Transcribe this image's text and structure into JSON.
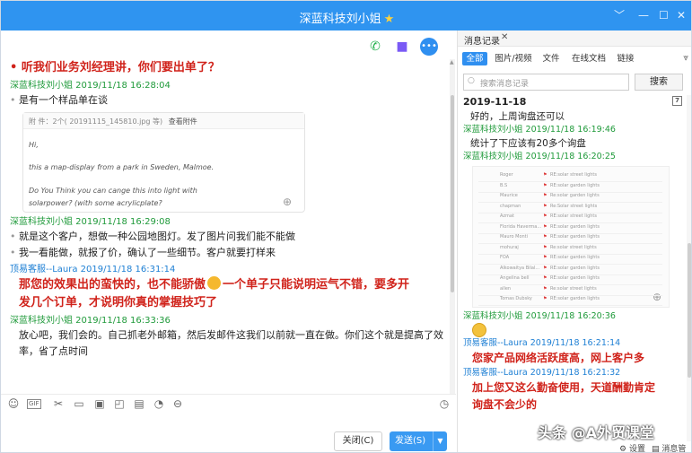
{
  "window": {
    "title": "深蓝科技刘小姐",
    "star_icon": "star-icon",
    "controls": [
      "chevron-down-icon",
      "minimize-icon",
      "maximize-icon",
      "close-icon"
    ],
    "colors": {
      "titlebar": "#2f94f0",
      "customer_name": "#1f9a3a",
      "agent_name": "#1d7fd4",
      "annotation": "#d0231b",
      "send_button": "#3a9af2"
    }
  },
  "chat": {
    "top_icons": [
      "phone-icon",
      "video-icon",
      "more-icon"
    ],
    "annotation_1": "听我们业务刘经理讲，你们要出单了？",
    "m1": {
      "sender": "深蓝科技刘小姐 2019/11/18 16:28:04",
      "lines": [
        "是有一个样品单在谈"
      ]
    },
    "mail": {
      "attach_prefix": "附 件：2个(",
      "attach_file": "20191115_145810.jpg 等)",
      "attach_view": "查看附件",
      "lines": [
        "Hi,",
        "this a map-display from a park in Sweden, Malmoe.",
        "Do You Think you can cange this into light with",
        "solarpower? (with some acrylicplate?"
      ]
    },
    "m2": {
      "sender": "深蓝科技刘小姐 2019/11/18 16:29:08",
      "lines": [
        "就是这个客户，想做一种公园地图灯。发了图片问我们能不能做",
        "我一看能做，就报了价，确认了一些细节。客户就要打样来"
      ]
    },
    "m3": {
      "sender": "顶易客服--Laura 2019/11/18 16:31:14",
      "annotation_a": "那您的效果出的蛮快的，",
      "annotation_b": "也不能骄傲",
      "annotation_c": "一个单子只能说明运气不错，要多开",
      "annotation_d": "发几个订单，才说明你真的掌握技巧了"
    },
    "m4": {
      "sender": "深蓝科技刘小姐 2019/11/18 16:33:36",
      "lines": [
        "放心吧，我们会的。自己抓老外邮箱，然后发邮件这我们以前就一直在做。你们这个就是提高了效",
        "率，省了点时间"
      ]
    }
  },
  "toolbar": {
    "icons": [
      "emoji-icon",
      "gif-icon",
      "scissors-icon",
      "folder-icon",
      "image-icon",
      "screenshot-icon",
      "document-icon",
      "audio-icon",
      "more-icon",
      "history-icon"
    ],
    "gif_label": "GIF"
  },
  "actions": {
    "close_label": "关闭(C)",
    "send_label": "发送(S)"
  },
  "history": {
    "tab_label": "消息记录",
    "filters": [
      "全部",
      "图片/视频",
      "文件",
      "在线文档",
      "链接"
    ],
    "active_filter": "全部",
    "search_placeholder": "搜索消息记录",
    "search_button": "搜索",
    "date": "2019-11-18",
    "r0": "好的，上周询盘还可以",
    "r1": {
      "sender": "深蓝科技刘小姐 2019/11/18 16:19:46",
      "text": "统计了下应该有20多个询盘"
    },
    "r2": {
      "sender": "深蓝科技刘小姐 2019/11/18 16:20:25"
    },
    "thumb_rows": [
      {
        "name": "Roger",
        "msg": "RE:solar street lights"
      },
      {
        "name": "B.S",
        "msg": "RE:solar garden lights"
      },
      {
        "name": "Maurice",
        "msg": "Re:solar garden lights"
      },
      {
        "name": "chapman",
        "msg": "Re:Solar street lights"
      },
      {
        "name": "Azmat",
        "msg": "RE:solar street lights"
      },
      {
        "name": "Florida Haverma...",
        "msg": "RE:solar garden lights"
      },
      {
        "name": "Mauro Monti",
        "msg": "RE:solar garden lights"
      },
      {
        "name": "mohuraj",
        "msg": "Re:solar street lights"
      },
      {
        "name": "FOA",
        "msg": "RE:solar garden lights"
      },
      {
        "name": "Alkowaitya Bilal...",
        "msg": "RE:solar garden lights"
      },
      {
        "name": "Angelina bell",
        "msg": "RE:solar garden lights"
      },
      {
        "name": "allen",
        "msg": "Re:solar street lights"
      },
      {
        "name": "Tomas Dubsky",
        "msg": "RE:solar garden lights"
      }
    ],
    "r3": {
      "sender": "深蓝科技刘小姐 2019/11/18 16:20:36"
    },
    "r4": {
      "sender": "顶易客服--Laura 2019/11/18 16:21:14",
      "text": "您家产品网络活跃度高，网上客户多"
    },
    "r5": {
      "sender": "顶易客服--Laura 2019/11/18 16:21:32",
      "text_a": "加上您又这么勤奋使用，天道酬勤肯定",
      "text_b": "询盘不会少的"
    },
    "settings_label": "设置",
    "manage_label": "消息管理"
  },
  "watermark": "头条 @A外贸课堂"
}
